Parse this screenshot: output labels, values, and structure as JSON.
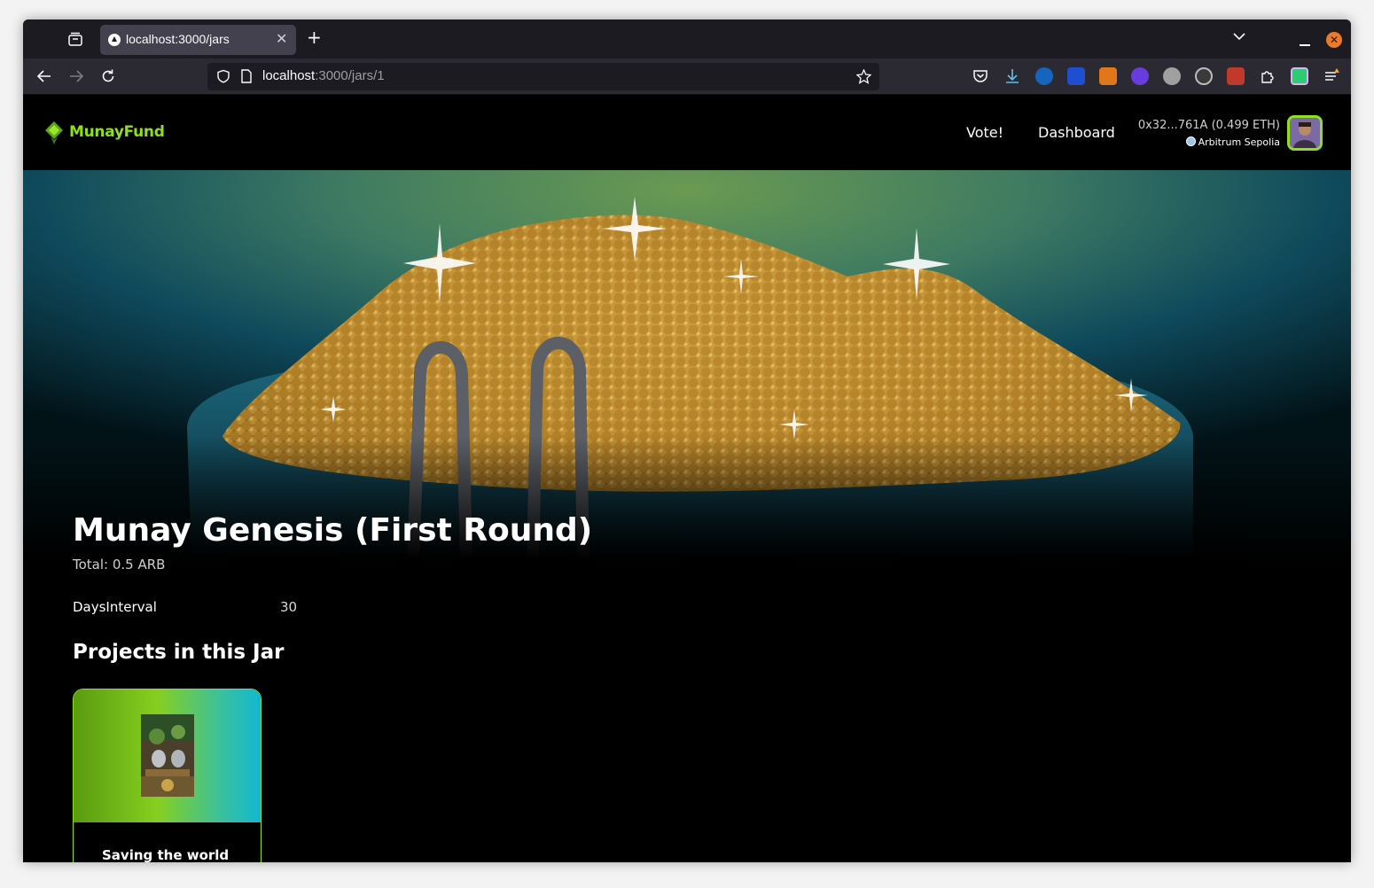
{
  "browser": {
    "tab_title": "localhost:3000/jars",
    "url_host": "localhost",
    "url_path": ":3000/jars/1"
  },
  "site": {
    "logo_text": "MunayFund",
    "nav": {
      "vote": "Vote!",
      "dashboard": "Dashboard"
    },
    "wallet": {
      "address": "0x32...761A (0.499 ETH)",
      "network": "Arbitrum Sepolia"
    }
  },
  "jar": {
    "title": "Munay Genesis (First Round)",
    "total": "Total: 0.5 ARB",
    "properties": [
      {
        "label": "DaysInterval",
        "value": "30"
      }
    ]
  },
  "projects_section": {
    "title": "Projects in this Jar",
    "projects": [
      {
        "name": "Saving the world"
      }
    ]
  },
  "colors": {
    "brand_green": "#8ee01f",
    "background": "#000000",
    "browser_chrome": "#2b2a33"
  }
}
